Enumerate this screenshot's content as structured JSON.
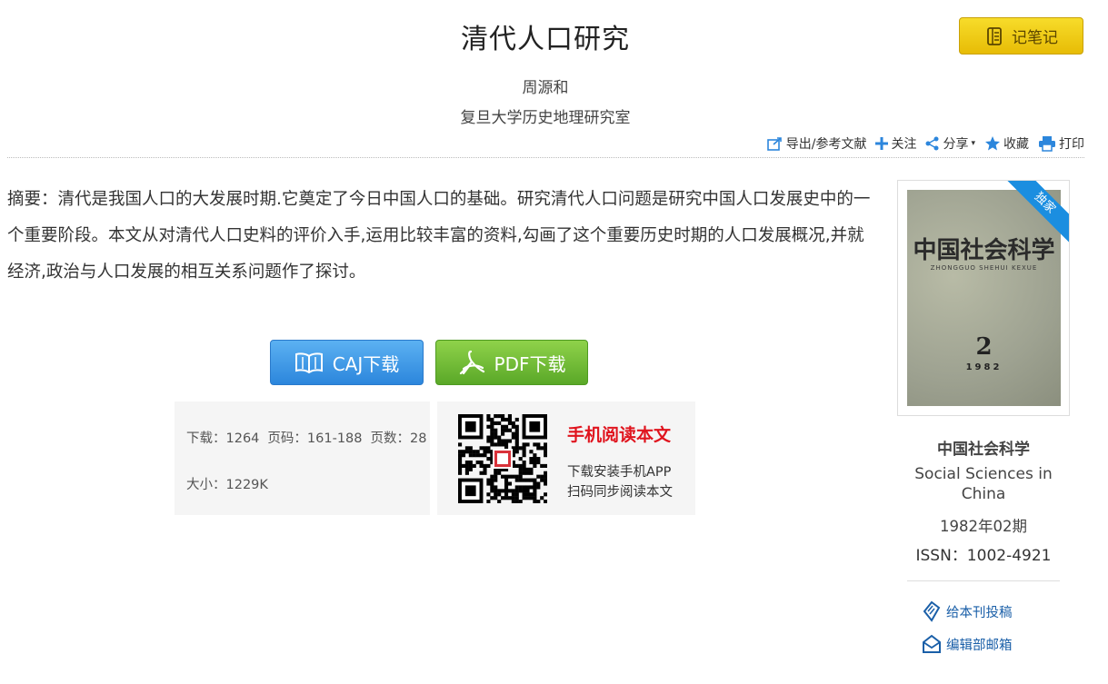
{
  "article": {
    "title": "清代人口研究",
    "author": "周源和",
    "organization": "复旦大学历史地理研究室",
    "abstract": "摘要：清代是我国人口的大发展时期.它奠定了今日中国人口的基础。研究清代人口问题是研究中国人口发展史中的一个重要阶段。本文从对清代人口史料的评价入手,运用比较丰富的资料,勾画了这个重要历史时期的人口发展概况,并就经济,政治与人口发展的相互关系问题作了探讨。"
  },
  "note_button": {
    "label": "记笔记",
    "icon": "notebook-icon"
  },
  "toolbar": {
    "export": "导出/参考文献",
    "follow": "关注",
    "share": "分享",
    "favorite": "收藏",
    "print": "打印"
  },
  "downloads": {
    "caj": "CAJ下载",
    "pdf": "PDF下载"
  },
  "stats": {
    "downloads": "下载：1264",
    "pages": "页码：161-188",
    "page_count": "页数：28",
    "size": "大小：1229K"
  },
  "mobile": {
    "title": "手机阅读本文",
    "line1": "下载安装手机APP",
    "line2": "扫码同步阅读本文"
  },
  "journal": {
    "cover_title": "中国社会科学",
    "cover_subtitle": "ZHONGGUO SHEHUI KEXUE",
    "cover_number": "2",
    "cover_year": "1982",
    "ribbon": "独家",
    "name_cn": "中国社会科学",
    "name_en": "Social Sciences in China",
    "issue": "1982年02期",
    "issn": "ISSN：1002-4921",
    "submit": "给本刊投稿",
    "mailbox": "编辑部邮箱"
  },
  "colors": {
    "caj_blue": "#2c86dc",
    "pdf_green": "#5aa828",
    "note_yellow": "#f0cc14",
    "mobile_red": "#e0141e",
    "link_blue": "#1a5fa8"
  }
}
